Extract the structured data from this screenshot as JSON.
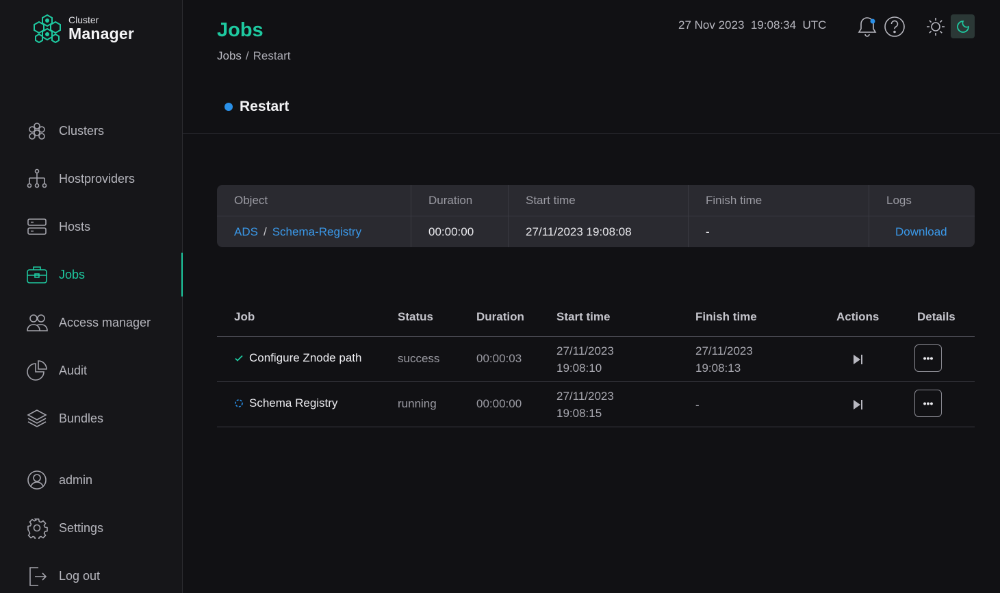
{
  "logo": {
    "small": "Cluster",
    "big": "Manager"
  },
  "sidebar": {
    "items": [
      {
        "label": "Clusters",
        "icon": "clusters-icon"
      },
      {
        "label": "Hostproviders",
        "icon": "hostproviders-icon"
      },
      {
        "label": "Hosts",
        "icon": "hosts-icon"
      },
      {
        "label": "Jobs",
        "icon": "jobs-icon",
        "active": true
      },
      {
        "label": "Access manager",
        "icon": "access-manager-icon"
      },
      {
        "label": "Audit",
        "icon": "audit-icon"
      },
      {
        "label": "Bundles",
        "icon": "bundles-icon"
      }
    ],
    "bottom": [
      {
        "label": "admin",
        "icon": "user-icon"
      },
      {
        "label": "Settings",
        "icon": "gear-icon"
      },
      {
        "label": "Log out",
        "icon": "logout-icon"
      }
    ]
  },
  "header": {
    "title": "Jobs",
    "breadcrumb": {
      "root": "Jobs",
      "sep": "/",
      "current": "Restart"
    },
    "datetime": "27 Nov 2023  19:08:34  UTC"
  },
  "job": {
    "name": "Restart",
    "status_color": "#2a90e8"
  },
  "object_table": {
    "headers": [
      "Object",
      "Duration",
      "Start time",
      "Finish time",
      "Logs"
    ],
    "row": {
      "object_parent": "ADS",
      "object_sep": "/",
      "object_child": "Schema-Registry",
      "duration": "00:00:00",
      "start": "27/11/2023 19:08:08",
      "finish": "-",
      "logs": "Download"
    }
  },
  "jobs_table": {
    "headers": {
      "job": "Job",
      "status": "Status",
      "duration": "Duration",
      "start": "Start time",
      "finish": "Finish time",
      "actions": "Actions",
      "details": "Details"
    },
    "rows": [
      {
        "name": "Configure Znode path",
        "status": "success",
        "duration": "00:00:03",
        "start_date": "27/11/2023",
        "start_time": "19:08:10",
        "finish_date": "27/11/2023",
        "finish_time": "19:08:13",
        "status_icon": "check-icon"
      },
      {
        "name": "Schema Registry",
        "status": "running",
        "duration": "00:00:00",
        "start_date": "27/11/2023",
        "start_time": "19:08:15",
        "finish_date": "-",
        "finish_time": "",
        "status_icon": "spinner-icon"
      }
    ],
    "details_label": "•••"
  },
  "colors": {
    "accent": "#1ec9a0",
    "link": "#3a98e8",
    "bg": "#111114",
    "sidebar": "#161619"
  }
}
